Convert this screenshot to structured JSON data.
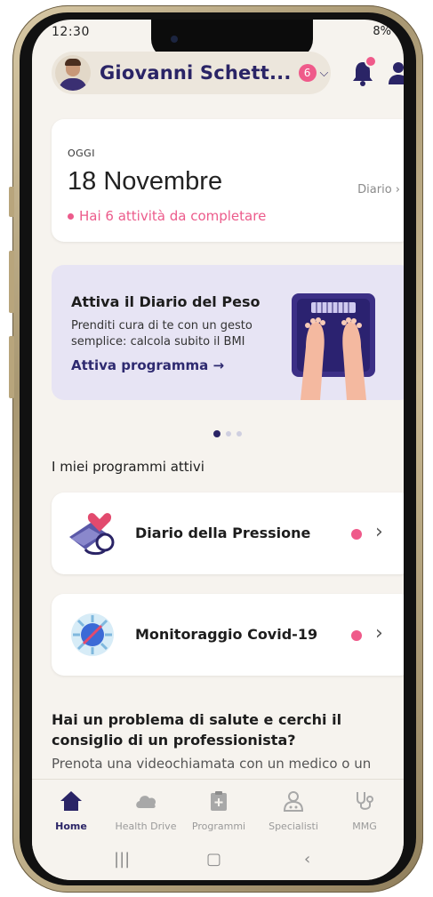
{
  "status": {
    "time": "12:30",
    "right": "8%"
  },
  "header": {
    "user_name": "Giovanni Schett...",
    "notification_count": "6"
  },
  "today_card": {
    "label": "OGGI",
    "date": "18 Novembre",
    "diario_link": "Diario",
    "pending_text": "Hai 6 attività da completare"
  },
  "promo": {
    "title": "Attiva il Diario del Peso",
    "text": "Prenditi cura di te con un gesto semplice: calcola subito il BMI",
    "cta": "Attiva programma →"
  },
  "active_programs": {
    "title": "I miei programmi attivi",
    "items": [
      {
        "label": "Diario della Pressione"
      },
      {
        "label": "Monitoraggio Covid-19"
      }
    ]
  },
  "help": {
    "title": "Hai un problema di salute e cerchi il consiglio di un professionista?",
    "text": "Prenota una videochiamata con un medico o un"
  },
  "tabs": [
    {
      "label": "Home"
    },
    {
      "label": "Health Drive"
    },
    {
      "label": "Programmi"
    },
    {
      "label": "Specialisti"
    },
    {
      "label": "MMG"
    }
  ],
  "colors": {
    "accent": "#2a2466",
    "pink": "#ef5a8a",
    "background": "#f6f3ee"
  }
}
